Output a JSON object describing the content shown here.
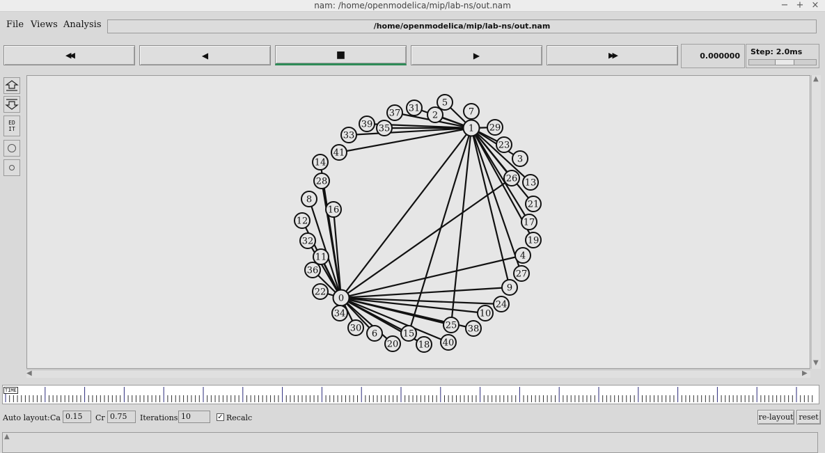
{
  "window": {
    "title": "nam: /home/openmodelica/mip/lab-ns/out.nam",
    "minimize": "−",
    "maximize": "+",
    "close": "×"
  },
  "menu": {
    "file": "File",
    "views": "Views",
    "analysis": "Analysis"
  },
  "file_path": "/home/openmodelica/mip/lab-ns/out.nam",
  "controls": {
    "rewind": "◀◀",
    "back": "◀",
    "stop": "■",
    "play": "▶",
    "fast_forward": "▶▶",
    "active": "stop"
  },
  "time": "0.000000",
  "step": {
    "label": "Step: 2.0ms",
    "slider_position": 0.55
  },
  "tools": {
    "edit": "EDIT"
  },
  "timeline_label": "TIME",
  "autolayout": {
    "label": "Auto layout:",
    "ca_label": "Ca",
    "ca_value": "0.15",
    "cr_label": "Cr",
    "cr_value": "0.75",
    "iterations_label": "Iterations",
    "iterations_value": "10",
    "recalc_label": "Recalc",
    "recalc_checked": true,
    "relayout": "re-layout",
    "reset": "reset"
  },
  "graph": {
    "nodes": [
      "0",
      "1",
      "2",
      "3",
      "4",
      "5",
      "6",
      "7",
      "8",
      "9",
      "10",
      "11",
      "12",
      "13",
      "14",
      "15",
      "16",
      "17",
      "18",
      "19",
      "20",
      "21",
      "22",
      "23",
      "24",
      "25",
      "26",
      "27",
      "28",
      "29",
      "30",
      "31",
      "32",
      "33",
      "34",
      "35",
      "36",
      "37",
      "38",
      "39",
      "40",
      "41"
    ],
    "edges_from_0": [
      "1",
      "4",
      "8",
      "9",
      "10",
      "11",
      "12",
      "14",
      "15",
      "16",
      "18",
      "20",
      "22",
      "24",
      "25",
      "26",
      "28",
      "30",
      "32",
      "34",
      "36",
      "38",
      "40",
      "6"
    ],
    "edges_from_1": [
      "0",
      "2",
      "3",
      "5",
      "7",
      "13",
      "15",
      "17",
      "19",
      "21",
      "23",
      "25",
      "27",
      "29",
      "31",
      "33",
      "35",
      "37",
      "39",
      "41",
      "9",
      "26"
    ]
  }
}
